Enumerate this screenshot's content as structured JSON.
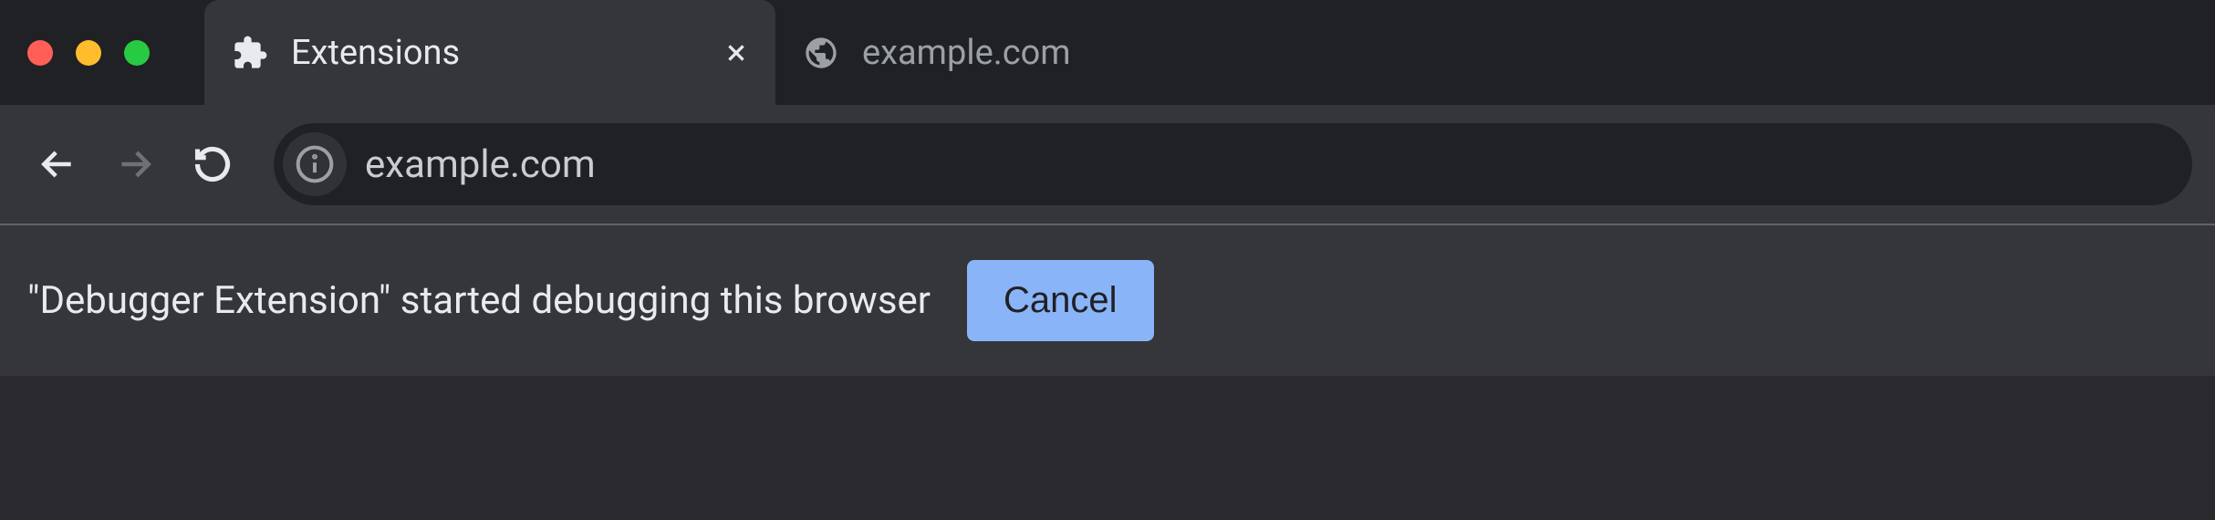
{
  "tabs": [
    {
      "title": "Extensions",
      "icon": "extension-icon",
      "active": true,
      "closeable": true
    },
    {
      "title": "example.com",
      "icon": "globe-icon",
      "active": false,
      "closeable": false
    }
  ],
  "navigation": {
    "back_enabled": true,
    "forward_enabled": false,
    "reload_enabled": true
  },
  "omnibox": {
    "url": "example.com",
    "site_info_icon": "info-icon"
  },
  "infobar": {
    "message": "\"Debugger Extension\" started debugging this browser",
    "cancel_label": "Cancel"
  }
}
